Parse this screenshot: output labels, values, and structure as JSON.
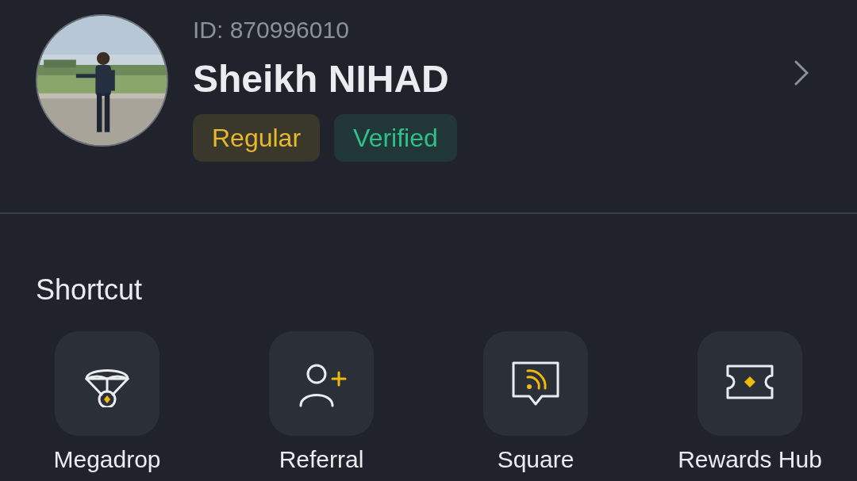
{
  "profile": {
    "id_text": "ID: 870996010",
    "name": "Sheikh NIHAD",
    "badges": [
      {
        "label": "Regular",
        "color": "#e8b92d"
      },
      {
        "label": "Verified",
        "color": "#2fbf8a"
      }
    ]
  },
  "shortcut": {
    "title": "Shortcut",
    "items": [
      {
        "label": "Megadrop",
        "kind": "parachute"
      },
      {
        "label": "Referral",
        "kind": "person-add"
      },
      {
        "label": "Square",
        "kind": "feed-chat"
      },
      {
        "label": "Rewards Hub",
        "kind": "ticket"
      }
    ]
  }
}
